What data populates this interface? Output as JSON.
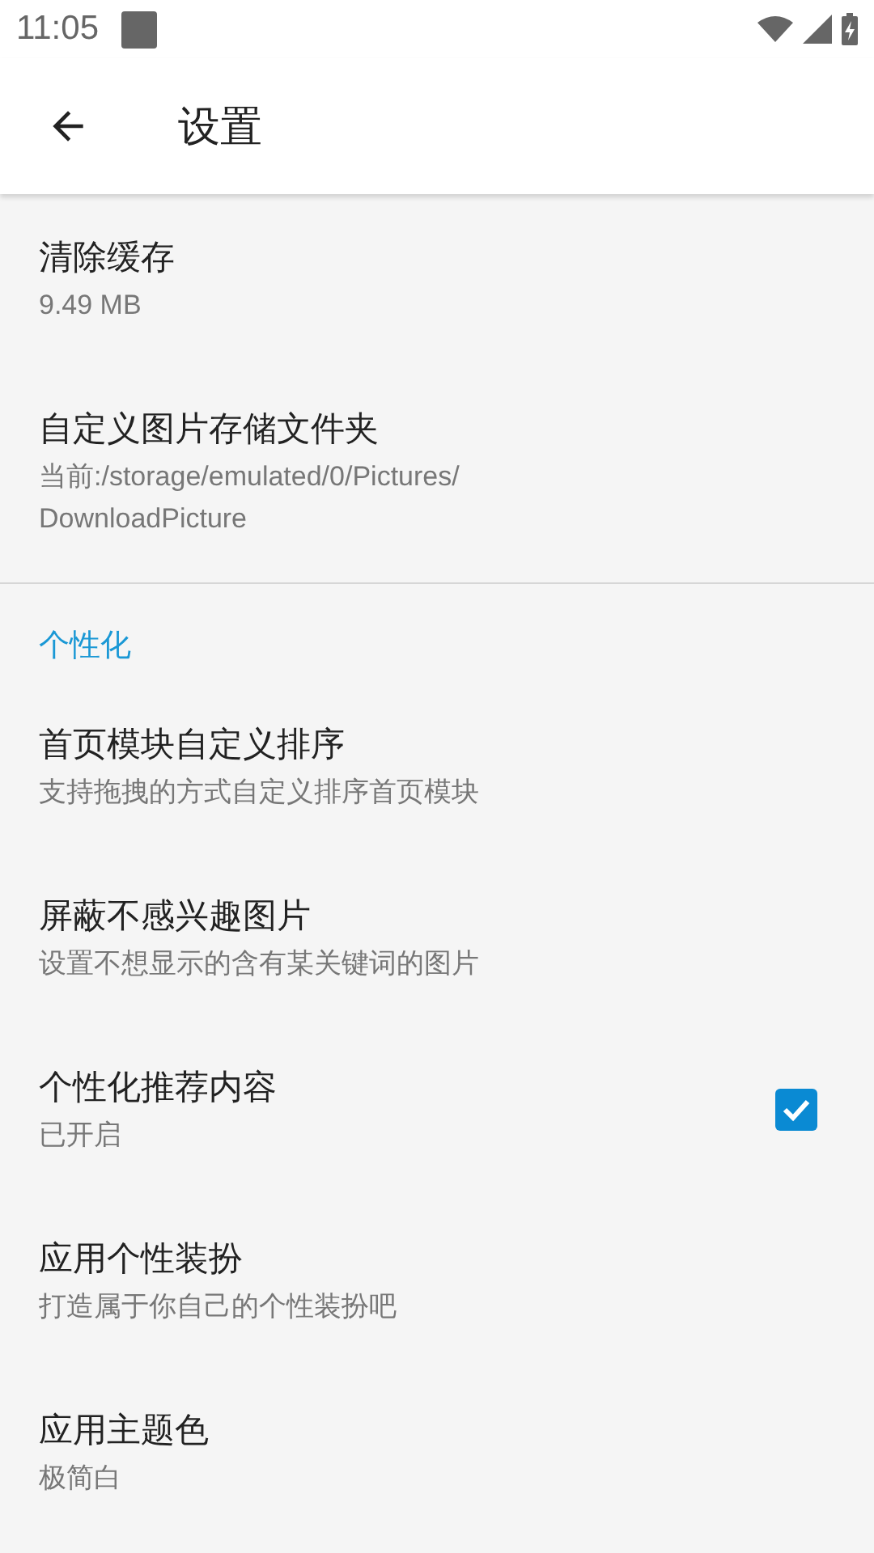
{
  "status_bar": {
    "time": "11:05"
  },
  "toolbar": {
    "title": "设置"
  },
  "sections": [
    {
      "items": [
        {
          "kind": "plain",
          "title": "清除缓存",
          "subtitle": "9.49 MB"
        },
        {
          "kind": "plain",
          "title": "自定义图片存储文件夹",
          "subtitle": "当前:/storage/emulated/0/Pictures/\nDownloadPicture"
        }
      ]
    },
    {
      "header": "个性化",
      "items": [
        {
          "kind": "plain",
          "title": "首页模块自定义排序",
          "subtitle": "支持拖拽的方式自定义排序首页模块"
        },
        {
          "kind": "plain",
          "title": "屏蔽不感兴趣图片",
          "subtitle": "设置不想显示的含有某关键词的图片"
        },
        {
          "kind": "checkbox",
          "title": "个性化推荐内容",
          "subtitle": "已开启",
          "checked": true
        },
        {
          "kind": "plain",
          "title": "应用个性装扮",
          "subtitle": "打造属于你自己的个性装扮吧"
        },
        {
          "kind": "plain",
          "title": "应用主题色",
          "subtitle": "极简白"
        }
      ]
    }
  ]
}
